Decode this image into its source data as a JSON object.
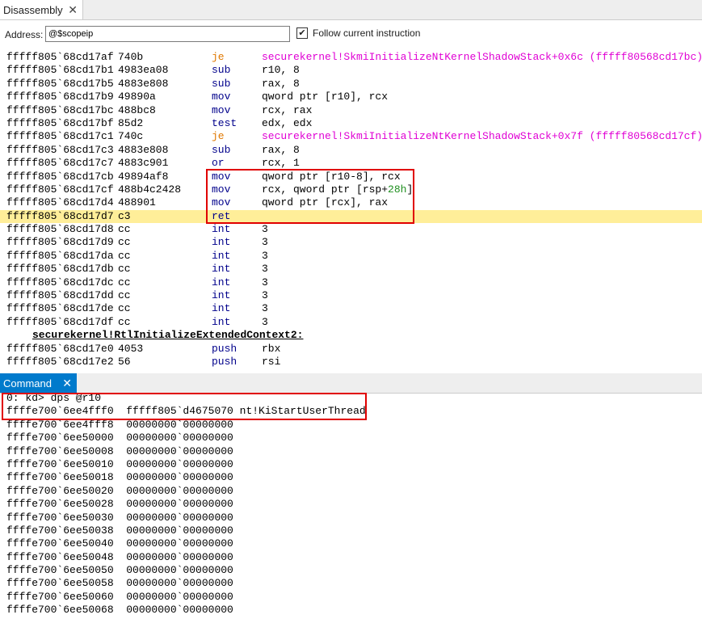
{
  "disassembly_tab": {
    "title": "Disassembly",
    "close": "✕"
  },
  "address": {
    "label": "Address:",
    "value": "@$scopeip"
  },
  "follow": {
    "checked": "✔",
    "label": "Follow current instruction"
  },
  "disassembly_lines": [
    {
      "addr": "fffff805`68cd17af",
      "bytes": "740b",
      "mnemonic": "je",
      "operands": "securekernel!SkmiInitializeNtKernelShadowStack+0x6c (fffff80568cd17bc)",
      "kind": "jump"
    },
    {
      "addr": "fffff805`68cd17b1",
      "bytes": "4983ea08",
      "mnemonic": "sub",
      "operands": "r10, 8"
    },
    {
      "addr": "fffff805`68cd17b5",
      "bytes": "4883e808",
      "mnemonic": "sub",
      "operands": "rax, 8"
    },
    {
      "addr": "fffff805`68cd17b9",
      "bytes": "49890a",
      "mnemonic": "mov",
      "operands": "qword ptr [r10], rcx"
    },
    {
      "addr": "fffff805`68cd17bc",
      "bytes": "488bc8",
      "mnemonic": "mov",
      "operands": "rcx, rax"
    },
    {
      "addr": "fffff805`68cd17bf",
      "bytes": "85d2",
      "mnemonic": "test",
      "operands": "edx, edx"
    },
    {
      "addr": "fffff805`68cd17c1",
      "bytes": "740c",
      "mnemonic": "je",
      "operands": "securekernel!SkmiInitializeNtKernelShadowStack+0x7f (fffff80568cd17cf)",
      "kind": "jump"
    },
    {
      "addr": "fffff805`68cd17c3",
      "bytes": "4883e808",
      "mnemonic": "sub",
      "operands": "rax, 8"
    },
    {
      "addr": "fffff805`68cd17c7",
      "bytes": "4883c901",
      "mnemonic": "or",
      "operands": "rcx, 1"
    },
    {
      "addr": "fffff805`68cd17cb",
      "bytes": "49894af8",
      "mnemonic": "mov",
      "operands": "qword ptr [r10-8], rcx"
    },
    {
      "addr": "fffff805`68cd17cf",
      "bytes": "488b4c2428",
      "mnemonic": "mov",
      "operands": "rcx, qword ptr [rsp+",
      "op_num": "28h",
      "op_tail": "]"
    },
    {
      "addr": "fffff805`68cd17d4",
      "bytes": "488901",
      "mnemonic": "mov",
      "operands": "qword ptr [rcx], rax"
    },
    {
      "addr": "fffff805`68cd17d7",
      "bytes": "c3",
      "mnemonic": "ret",
      "operands": "",
      "current": true
    },
    {
      "addr": "fffff805`68cd17d8",
      "bytes": "cc",
      "mnemonic": "int",
      "operands": "3"
    },
    {
      "addr": "fffff805`68cd17d9",
      "bytes": "cc",
      "mnemonic": "int",
      "operands": "3"
    },
    {
      "addr": "fffff805`68cd17da",
      "bytes": "cc",
      "mnemonic": "int",
      "operands": "3"
    },
    {
      "addr": "fffff805`68cd17db",
      "bytes": "cc",
      "mnemonic": "int",
      "operands": "3"
    },
    {
      "addr": "fffff805`68cd17dc",
      "bytes": "cc",
      "mnemonic": "int",
      "operands": "3"
    },
    {
      "addr": "fffff805`68cd17dd",
      "bytes": "cc",
      "mnemonic": "int",
      "operands": "3"
    },
    {
      "addr": "fffff805`68cd17de",
      "bytes": "cc",
      "mnemonic": "int",
      "operands": "3"
    },
    {
      "addr": "fffff805`68cd17df",
      "bytes": "cc",
      "mnemonic": "int",
      "operands": "3"
    },
    {
      "label": "securekernel!RtlInitializeExtendedContext2:"
    },
    {
      "addr": "fffff805`68cd17e0",
      "bytes": "4053",
      "mnemonic": "push",
      "operands": "rbx"
    },
    {
      "addr": "fffff805`68cd17e2",
      "bytes": "56",
      "mnemonic": "push",
      "operands": "rsi"
    }
  ],
  "command_tab": {
    "title": "Command",
    "close": "✕"
  },
  "command_lines": [
    "0: kd> dps @r10",
    "ffffe700`6ee4fff0  fffff805`d4675070 nt!KiStartUserThread",
    "ffffe700`6ee4fff8  00000000`00000000",
    "ffffe700`6ee50000  00000000`00000000",
    "ffffe700`6ee50008  00000000`00000000",
    "ffffe700`6ee50010  00000000`00000000",
    "ffffe700`6ee50018  00000000`00000000",
    "ffffe700`6ee50020  00000000`00000000",
    "ffffe700`6ee50028  00000000`00000000",
    "ffffe700`6ee50030  00000000`00000000",
    "ffffe700`6ee50038  00000000`00000000",
    "ffffe700`6ee50040  00000000`00000000",
    "ffffe700`6ee50048  00000000`00000000",
    "ffffe700`6ee50050  00000000`00000000",
    "ffffe700`6ee50058  00000000`00000000",
    "ffffe700`6ee50060  00000000`00000000",
    "ffffe700`6ee50068  00000000`00000000"
  ],
  "colors": {
    "current_line": "#ffee99",
    "highlight_box": "#e00000",
    "command_tab": "#007acc"
  }
}
